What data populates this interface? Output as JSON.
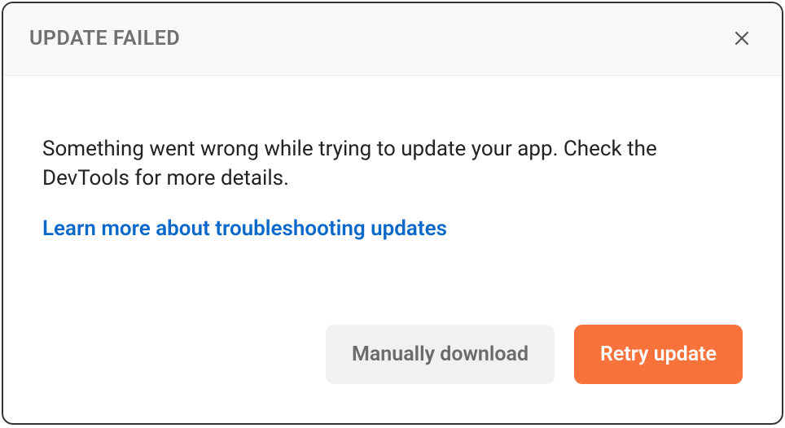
{
  "header": {
    "title": "UPDATE FAILED"
  },
  "body": {
    "message": "Something went wrong while trying to update your app. Check the DevTools for more details.",
    "link_text": "Learn more about troubleshooting updates"
  },
  "footer": {
    "secondary_label": "Manually download",
    "primary_label": "Retry update"
  }
}
